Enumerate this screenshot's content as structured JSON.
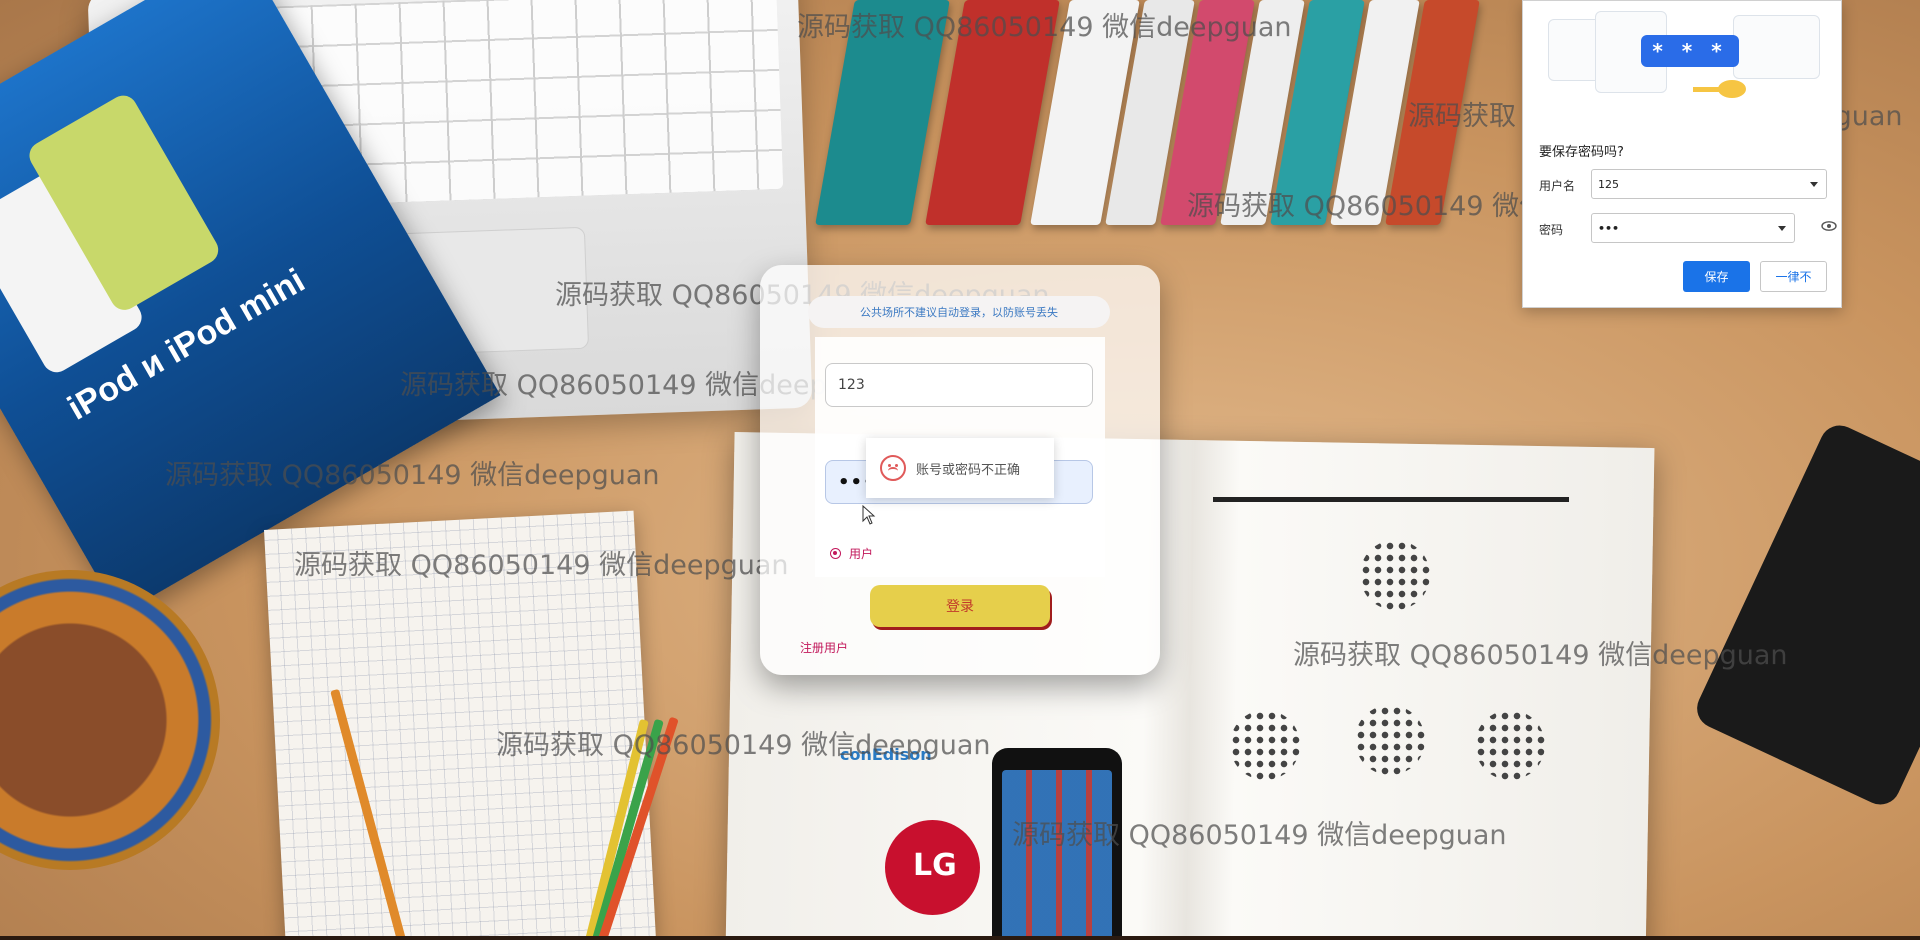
{
  "watermark_text": "源码获取 QQ86050149 微信deepguan",
  "background": {
    "ipod_card_title": "iPod и iPod mini",
    "lg_logo": "LG",
    "conedison_logo": "conEdison"
  },
  "login": {
    "notice": "公共场所不建议自动登录，以防账号丢失",
    "username_value": "123",
    "password_value": "•••",
    "role_option": "用户",
    "login_button": "登录",
    "register_link": "注册用户"
  },
  "toast": {
    "message": "账号或密码不正确",
    "icon": "sad-face-icon"
  },
  "password_bubble": {
    "illustration_mask": "* * *",
    "title": "要保存密码吗?",
    "username_label": "用户名",
    "username_value": "125",
    "password_label": "密码",
    "password_value": "•••",
    "save_button": "保存",
    "never_button": "一律不"
  },
  "colors": {
    "accent_blue": "#1a73e8",
    "login_button": "#e6cf4b",
    "pink_text": "#c2185b",
    "notice_text": "#3b79c2"
  }
}
